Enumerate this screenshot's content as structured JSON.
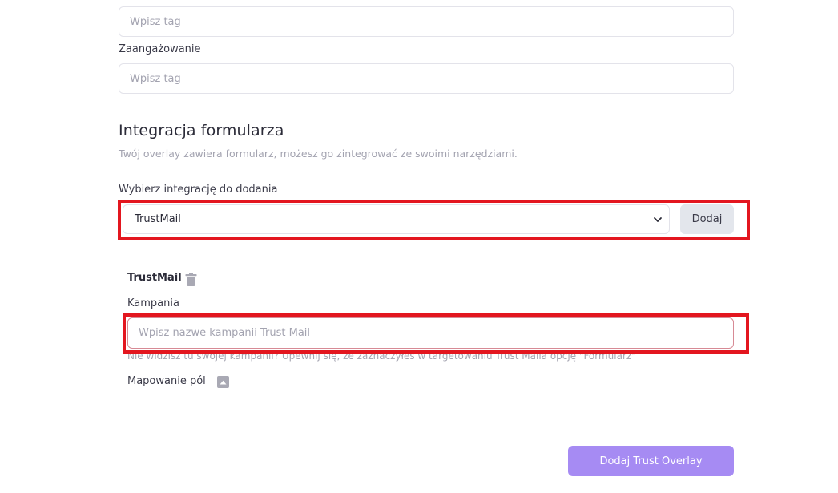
{
  "tags": {
    "top_input_placeholder": "Wpisz tag",
    "engagement_label": "Zaangażowanie",
    "engagement_input_placeholder": "Wpisz tag"
  },
  "integration": {
    "title": "Integracja formularza",
    "subtitle": "Twój overlay zawiera formularz, możesz go zintegrować ze swoimi narzędziami.",
    "select_label": "Wybierz integrację do dodania",
    "selected_value": "TrustMail",
    "add_button_label": "Dodaj"
  },
  "trustmail_block": {
    "name": "TrustMail",
    "campaign_label": "Kampania",
    "campaign_placeholder": "Wpisz nazwe kampanii Trust Mail",
    "campaign_help": "Nie widzisz tu swojej kampanii? Upewnij się, że zaznaczyłeś w targetowaniu Trust Maila opcję \"Formularz\"",
    "mapping_label": "Mapowanie pól"
  },
  "footer": {
    "submit_label": "Dodaj Trust Overlay"
  },
  "colors": {
    "primary": "#a68bf3",
    "highlight": "#e3161f",
    "muted_text": "#a3a3b0"
  }
}
